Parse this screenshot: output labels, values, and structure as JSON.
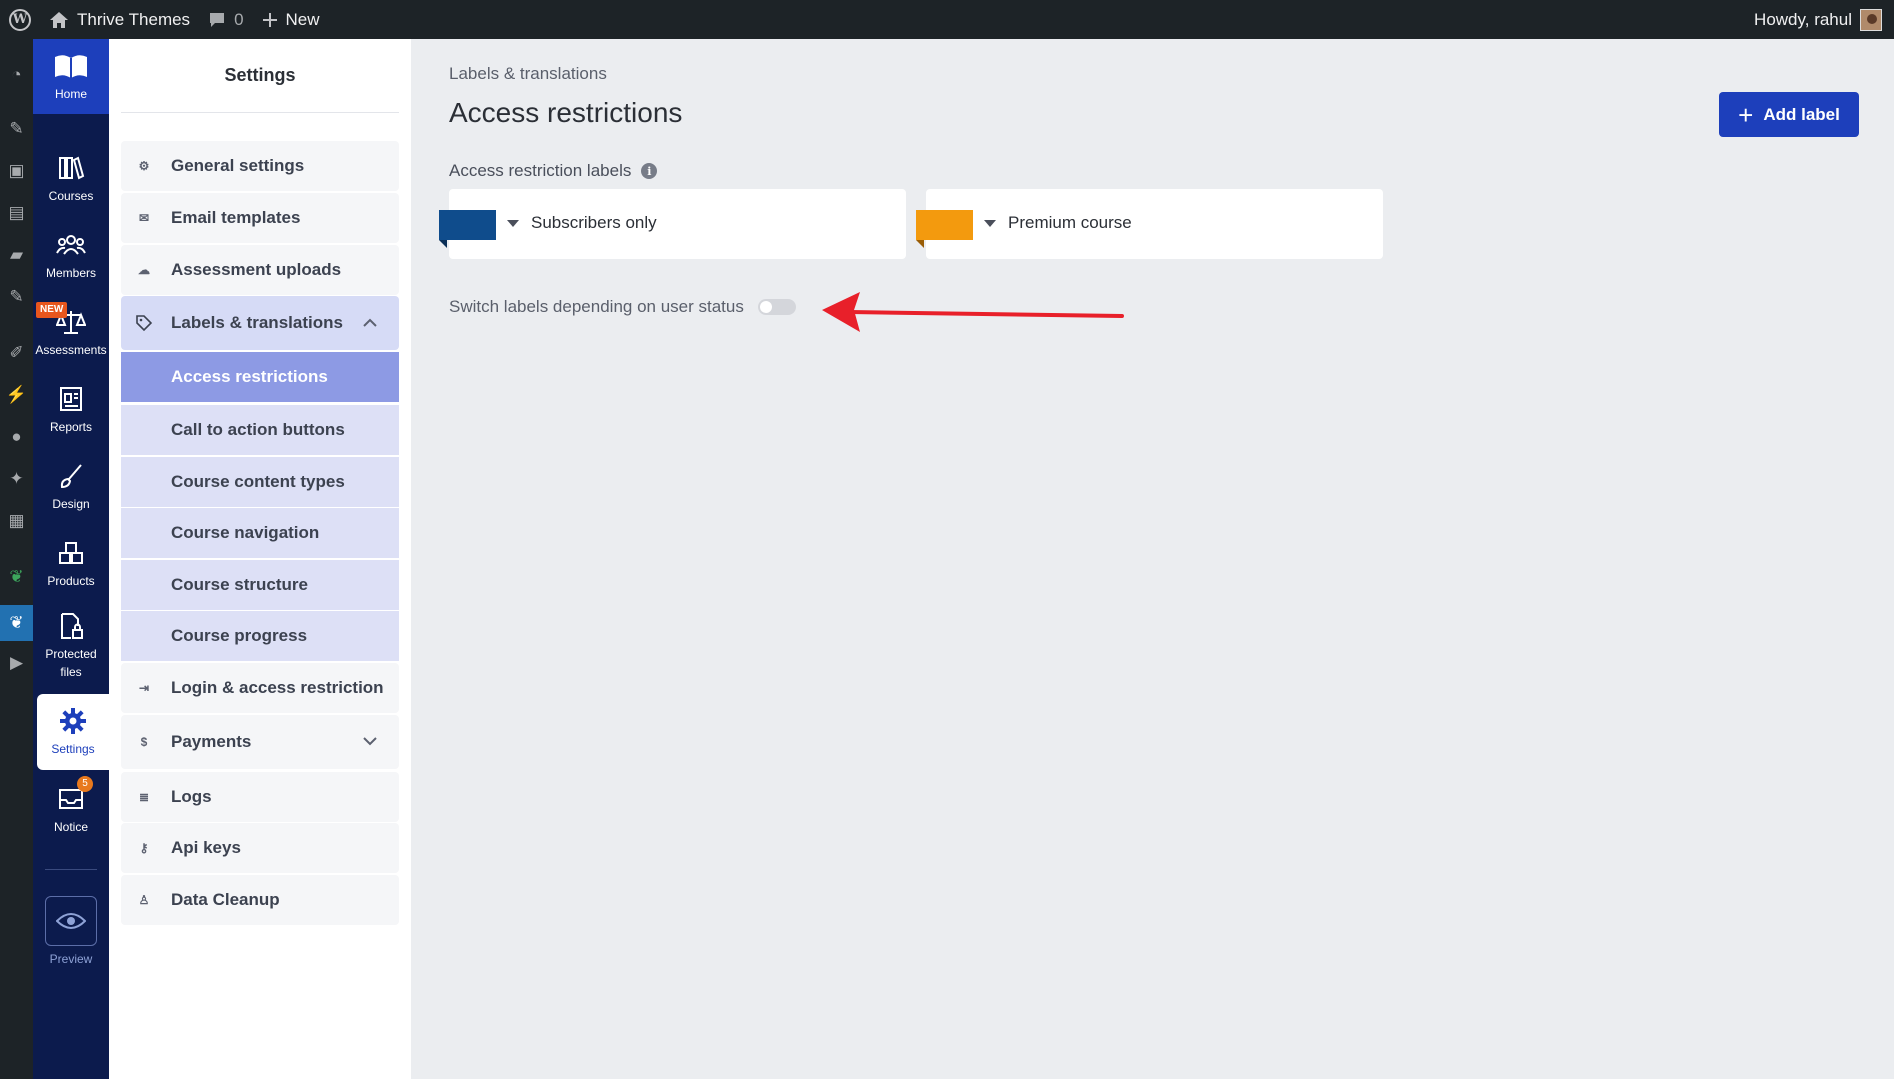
{
  "adminbar": {
    "site_name": "Thrive Themes",
    "comments_count": "0",
    "new_label": "New",
    "howdy": "Howdy, rahul"
  },
  "wp_menu_icons": [
    "dashboard-icon",
    "pin-icon",
    "media-icon",
    "pages-icon",
    "comments-icon",
    "pin-icon",
    "brush-icon",
    "plugin-icon",
    "user-icon",
    "wrench-icon",
    "settings-icon",
    "leaf-icon",
    "leaf-icon",
    "play-icon"
  ],
  "thrive_nav": {
    "home": "Home",
    "items": [
      {
        "label": "Courses",
        "icon": "books-icon"
      },
      {
        "label": "Members",
        "icon": "users-icon"
      },
      {
        "label": "Assessments",
        "icon": "scales-icon",
        "badge": "NEW"
      },
      {
        "label": "Reports",
        "icon": "report-icon"
      },
      {
        "label": "Design",
        "icon": "brush-icon"
      },
      {
        "label": "Products",
        "icon": "boxes-icon"
      },
      {
        "label": "Protected files",
        "icon": "file-lock-icon"
      },
      {
        "label": "Settings",
        "icon": "gear-icon"
      },
      {
        "label": "Notice",
        "icon": "inbox-icon",
        "count": "5"
      }
    ],
    "preview": "Preview"
  },
  "settings": {
    "title": "Settings",
    "items": [
      {
        "label": "General settings",
        "icon": "gear-icon"
      },
      {
        "label": "Email templates",
        "icon": "envelope-icon"
      },
      {
        "label": "Assessment uploads",
        "icon": "upload-icon"
      },
      {
        "label": "Labels & translations",
        "icon": "tag-icon"
      }
    ],
    "sub_items": [
      {
        "label": "Access restrictions"
      },
      {
        "label": "Call to action buttons"
      },
      {
        "label": "Course content types"
      },
      {
        "label": "Course navigation"
      },
      {
        "label": "Course structure"
      },
      {
        "label": "Course progress"
      }
    ],
    "items_after": [
      {
        "label": "Login & access restriction",
        "icon": "login-icon"
      },
      {
        "label": "Payments",
        "icon": "dollar-icon"
      },
      {
        "label": "Logs",
        "icon": "list-icon"
      },
      {
        "label": "Api keys",
        "icon": "key-icon"
      },
      {
        "label": "Data Cleanup",
        "icon": "broom-icon"
      }
    ]
  },
  "main": {
    "breadcrumb": "Labels & translations",
    "title": "Access restrictions",
    "add_button": "Add label",
    "labels_heading": "Access restriction labels",
    "labels": [
      {
        "text": "Subscribers only",
        "color": "#0f4c8c"
      },
      {
        "text": "Premium course",
        "color": "#f39a0e"
      }
    ],
    "switch_text": "Switch labels depending on user status",
    "switch_on": false
  }
}
